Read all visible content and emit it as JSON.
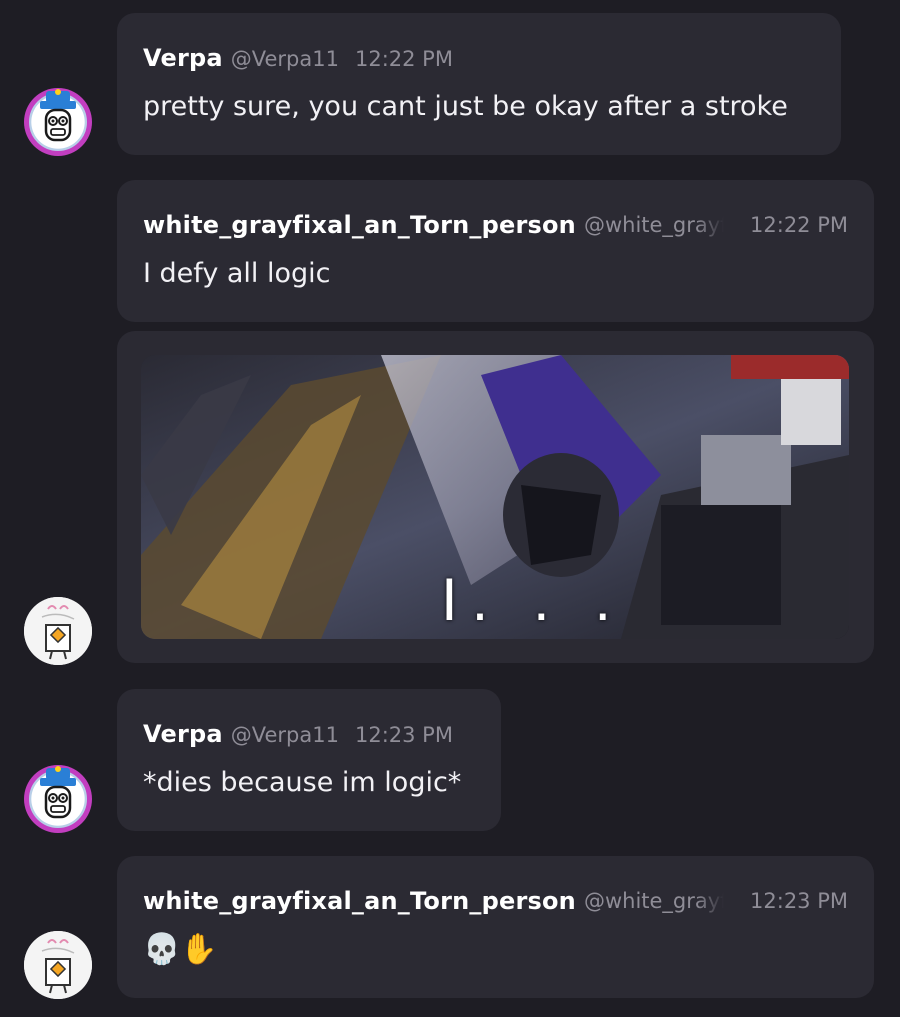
{
  "messages": [
    {
      "author": "Verpa",
      "handle": "@Verpa11",
      "time": "12:22 PM",
      "text": "pretty sure, you cant just be okay after a stroke"
    },
    {
      "author": "white_grayfixal_an_Torn_person",
      "handle": "@white_grayf",
      "time": "12:22 PM",
      "text": "I defy all logic"
    },
    {
      "gif_caption": "I. . ."
    },
    {
      "author": "Verpa",
      "handle": "@Verpa11",
      "time": "12:23 PM",
      "text": "*dies because im logic*"
    },
    {
      "author": "white_grayfixal_an_Torn_person",
      "handle": "@white_grayf",
      "time": "12:23 PM",
      "text": "💀✋"
    }
  ],
  "colors": {
    "background": "#1e1d24",
    "bubble": "#2b2a33",
    "author": "#ffffff",
    "meta": "#8f8d97",
    "text": "#f2f1f5"
  },
  "icons": [
    "verpa-avatar",
    "white-grayfixal-avatar",
    "skull-emoji",
    "raised-hand-emoji"
  ]
}
